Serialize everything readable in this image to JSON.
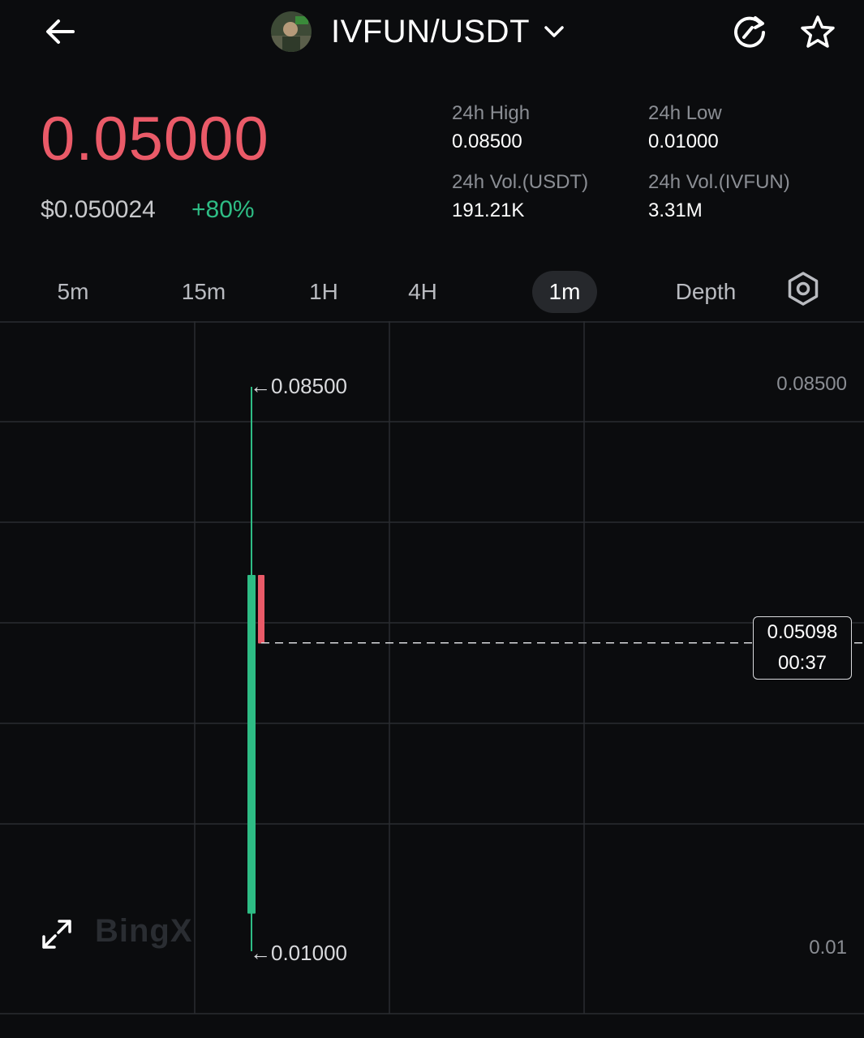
{
  "header": {
    "pair": "IVFUN/USDT"
  },
  "ticker": {
    "last_price": "0.05000",
    "usd_price": "$0.050024",
    "change_pct": "+80%",
    "high_label": "24h High",
    "high_value": "0.08500",
    "low_label": "24h Low",
    "low_value": "0.01000",
    "vol_usdt_label": "24h Vol.(USDT)",
    "vol_usdt_value": "191.21K",
    "vol_base_label": "24h Vol.(IVFUN)",
    "vol_base_value": "3.31M"
  },
  "tabs": [
    {
      "label": "5m",
      "active": false
    },
    {
      "label": "15m",
      "active": false
    },
    {
      "label": "1H",
      "active": false
    },
    {
      "label": "4H",
      "active": false
    },
    {
      "label": "1m",
      "active": true
    },
    {
      "label": "Depth",
      "active": false
    }
  ],
  "colors": {
    "up": "#2ebd85",
    "down": "#ea5a68",
    "background": "#0b0c0e"
  },
  "icons": [
    "arrow-left-icon",
    "chevron-down-icon",
    "refresh-icon",
    "star-icon",
    "settings-hex-icon",
    "expand-icon"
  ],
  "chart": {
    "watermark": "BingX",
    "axis_top": "0.08500",
    "axis_bottom": "0.01",
    "high_marker": "←0.08500",
    "low_marker": "←0.01000",
    "current_price": "0.05098",
    "countdown": "00:37"
  },
  "chart_data": {
    "type": "candlestick",
    "y_axis_labels": [
      "0.08500",
      "0.01"
    ],
    "candles": [
      {
        "open": 0.015,
        "high": 0.085,
        "low": 0.01,
        "close": 0.06,
        "direction": "up"
      },
      {
        "open": 0.06,
        "high": 0.06,
        "low": 0.0509,
        "close": 0.0509,
        "direction": "down"
      }
    ],
    "current_price": 0.05098
  }
}
